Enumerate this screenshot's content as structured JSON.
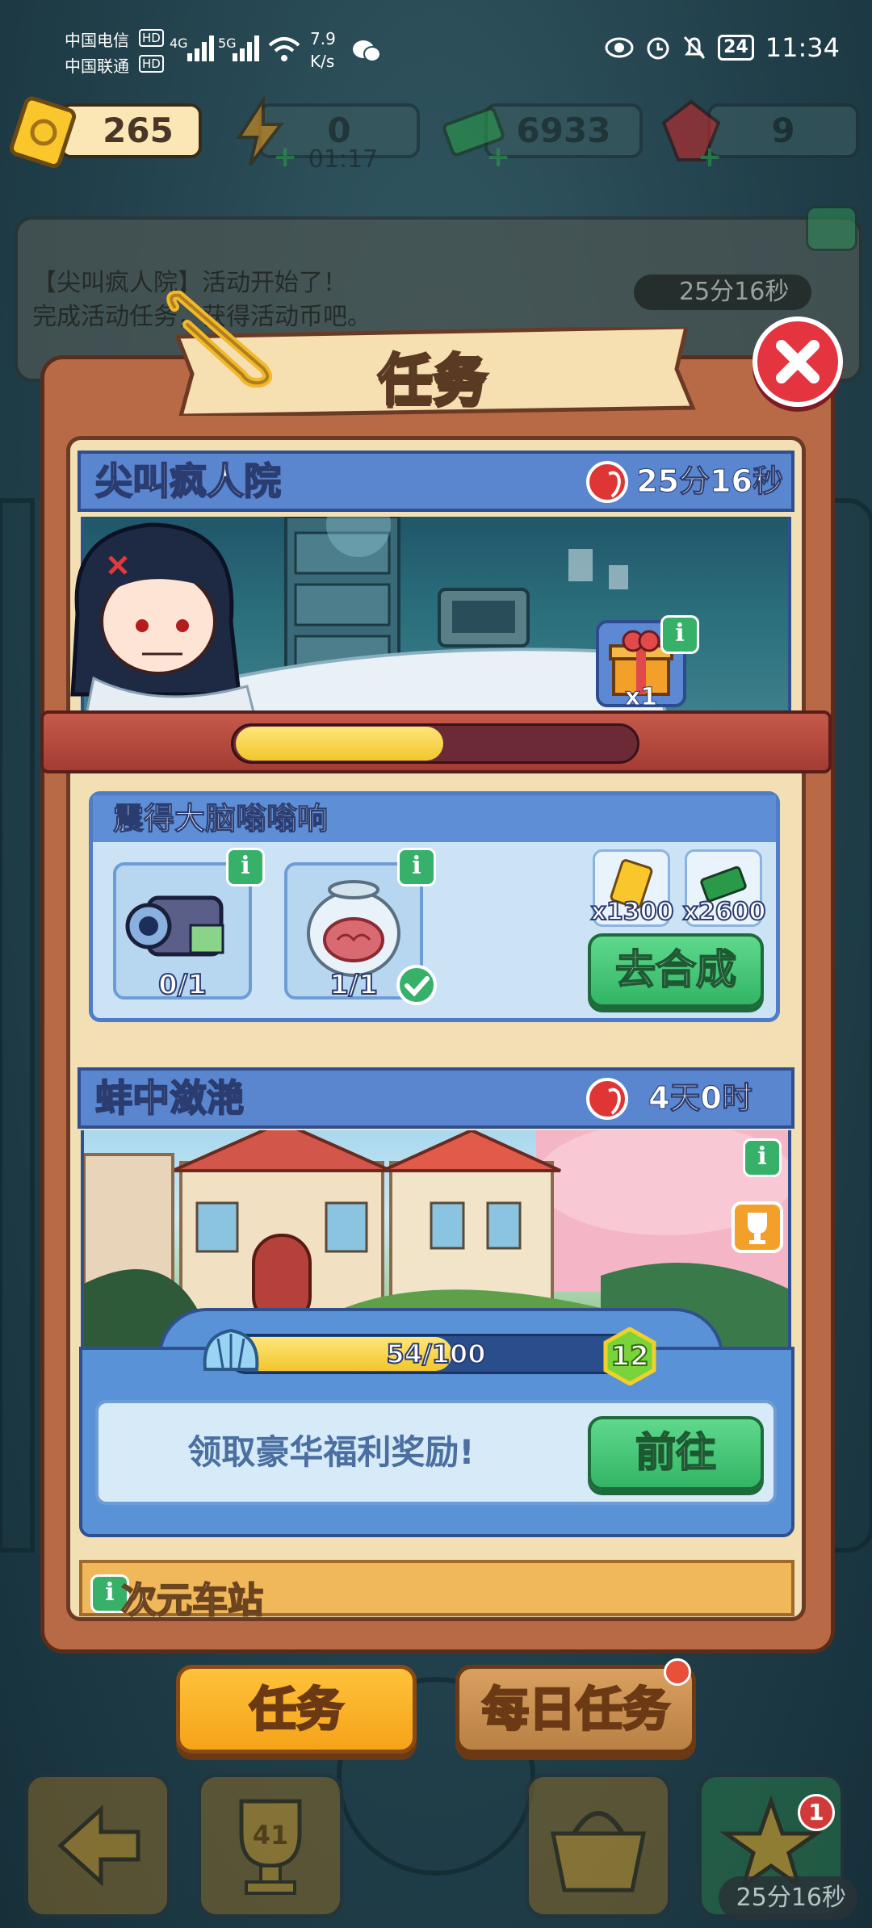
{
  "status_bar": {
    "carrier1": "中国电信",
    "carrier2": "中国联通",
    "hd": "HD",
    "net1": "4G",
    "net2": "5G",
    "speed_value": "7.9",
    "speed_unit": "K/s",
    "battery": "24",
    "time": "11:34"
  },
  "resources": {
    "tickets": "265",
    "energy": "0",
    "energy_timer": "01:17",
    "cash": "6933",
    "gems": "9"
  },
  "notice": {
    "line1": "【尖叫疯人院】活动开始了！",
    "line2": "完成活动任务，获得活动币吧。",
    "timer": "25分16秒"
  },
  "modal": {
    "title": "任务"
  },
  "event_card": {
    "title": "尖叫疯人院",
    "timer": "25分16秒",
    "gift_count": "x1",
    "progress": 0.52
  },
  "subtask": {
    "title": "震得大脑嗡嗡响",
    "items": [
      {
        "name": "camcorder",
        "count": "0/1",
        "done": false
      },
      {
        "name": "brain-jar",
        "count": "1/1",
        "done": true
      }
    ],
    "rewards": [
      {
        "icon": "ticket-icon",
        "amount": "x1300"
      },
      {
        "icon": "cash-icon",
        "amount": "x2600"
      }
    ],
    "action_label": "去合成"
  },
  "pass_card": {
    "title": "蚌中潋滟",
    "timer": "4天0时",
    "progress_text": "54/100",
    "progress": 0.54,
    "level": "12",
    "claim_text": "领取豪华福利奖励!",
    "go_label": "前往"
  },
  "next_card": {
    "title_partial": "次元车站"
  },
  "tabs": {
    "task": "任务",
    "daily": "每日任务"
  },
  "bottom_nav": {
    "trophy_level": "41",
    "badge": "1",
    "timer": "25分16秒"
  },
  "colors": {
    "accent_blue": "#5a86d0",
    "accent_green": "#33b565",
    "accent_orange": "#f5a319",
    "close_red": "#e3343f"
  }
}
